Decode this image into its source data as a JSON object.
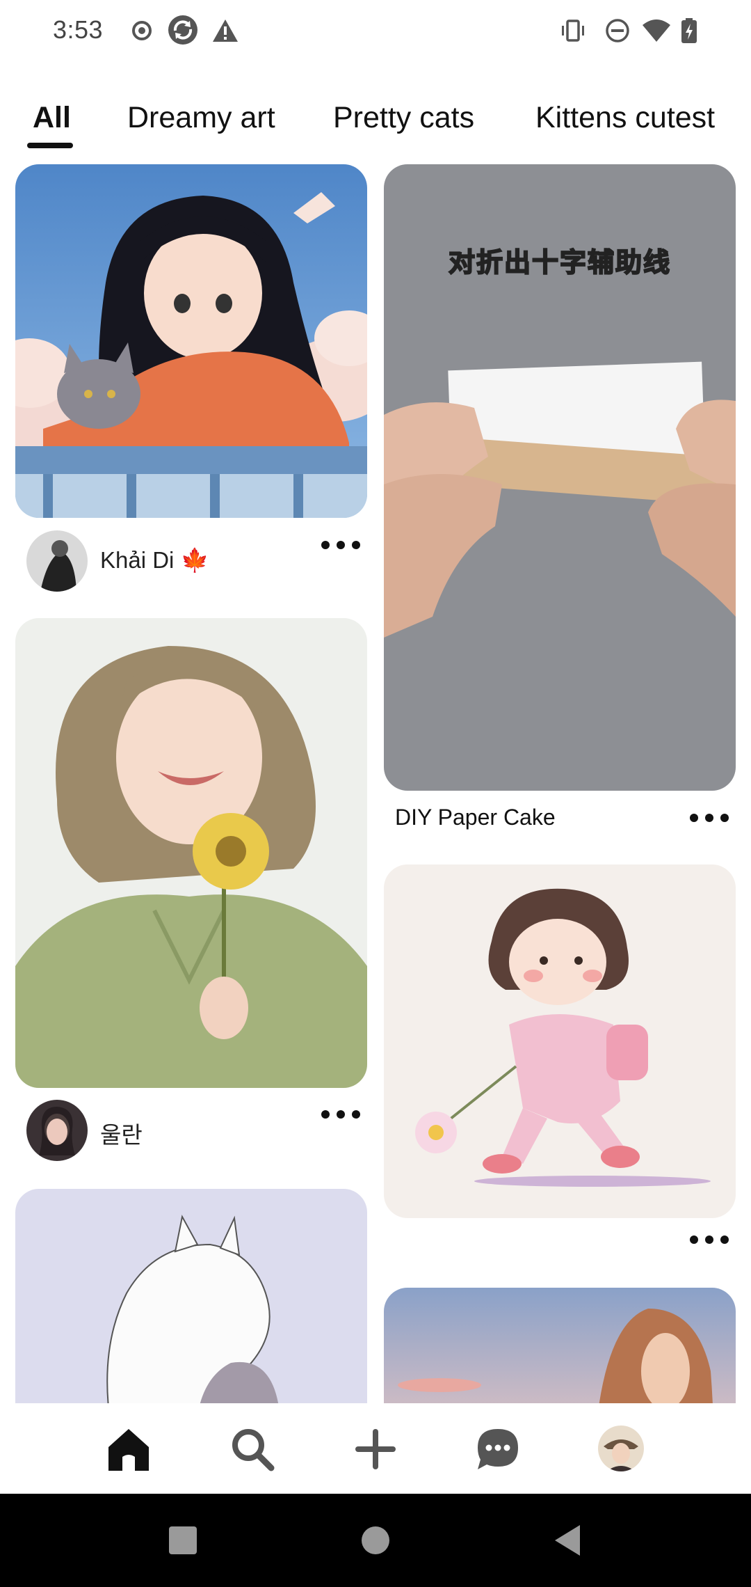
{
  "status_bar": {
    "time": "3:53",
    "left_icons": [
      "record-icon",
      "sync-icon",
      "warning-icon"
    ],
    "right_icons": [
      "vibrate-icon",
      "do-not-disturb-icon",
      "wifi-icon",
      "battery-charging-icon"
    ]
  },
  "tabs": [
    {
      "label": "All",
      "active": true
    },
    {
      "label": "Dreamy art",
      "active": false
    },
    {
      "label": "Pretty cats",
      "active": false
    },
    {
      "label": "Kittens cutest",
      "active": false
    }
  ],
  "pins": {
    "left": [
      {
        "user": "Khải Di 🍁",
        "image": "anime girl with grey cat"
      },
      {
        "user": "울란",
        "image": "girl holding sunflower"
      },
      {
        "image": "white cat hugging girl"
      }
    ],
    "right": [
      {
        "title": "DIY Paper Cake",
        "overlay_text": "对折出十字辅助线",
        "image": "hands folding paper"
      },
      {
        "title": "",
        "image": "little girl walking with flower"
      },
      {
        "image": "girl at sunset"
      }
    ]
  },
  "bottom_nav": {
    "items": [
      "home-icon",
      "search-icon",
      "create-icon",
      "messages-icon",
      "profile-avatar"
    ],
    "active": "home-icon"
  },
  "colors": {
    "text": "#111111",
    "background": "#ffffff",
    "system_nav": "#000000"
  }
}
